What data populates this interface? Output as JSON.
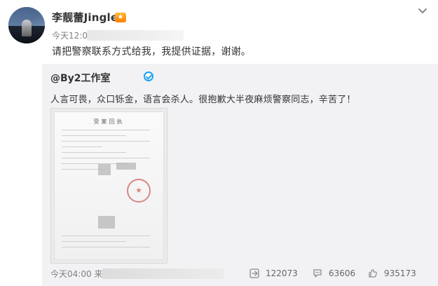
{
  "header": {
    "username": "李靓蕾Jinglei",
    "timestamp": "今天12:0",
    "vip_icon": "crown-icon"
  },
  "post": {
    "main_text": "请把警察联系方式给我，我提供证据，谢谢。"
  },
  "repost": {
    "author": "@By2工作室",
    "body": "人言可畏，众口铄金，语言会杀人。很抱歉大半夜麻烦警察同志，辛苦了！",
    "image_icon": "document-photo-icon",
    "footer_time": "今天04:00 来自"
  },
  "stats": {
    "repost_count": "122073",
    "comment_count": "63606",
    "like_count": "935173"
  },
  "document": {
    "title": "受案回执"
  }
}
